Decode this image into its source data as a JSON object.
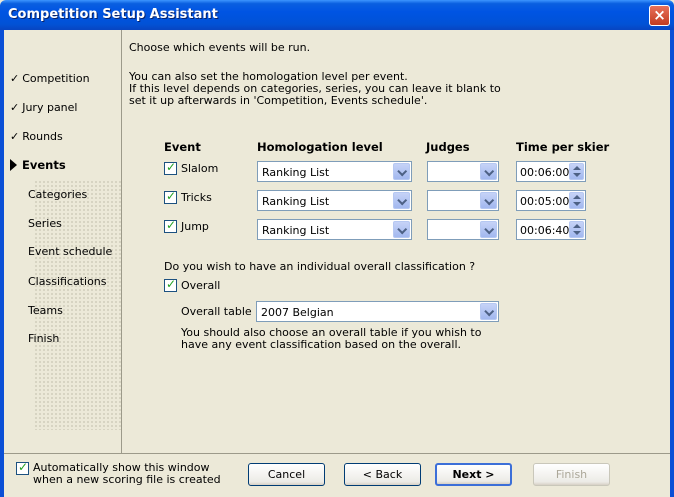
{
  "window": {
    "title": "Competition Setup Assistant",
    "close_glyph": "×"
  },
  "sidebar": {
    "items": [
      {
        "label": "Competition",
        "state": "done"
      },
      {
        "label": "Jury panel",
        "state": "done"
      },
      {
        "label": "Rounds",
        "state": "done"
      },
      {
        "label": "Events",
        "state": "current"
      },
      {
        "label": "Categories",
        "state": "todo"
      },
      {
        "label": "Series",
        "state": "todo"
      },
      {
        "label": "Event schedule",
        "state": "todo"
      },
      {
        "label": "Classifications",
        "state": "todo"
      },
      {
        "label": "Teams",
        "state": "todo"
      },
      {
        "label": "Finish",
        "state": "todo"
      }
    ]
  },
  "main": {
    "intro": "Choose which events will be run.",
    "info1": "You can also set the homologation level per event.",
    "info2": "If this level depends on categories, series, you can leave it blank to",
    "info3": "set it up afterwards in 'Competition, Events schedule'.",
    "headers": {
      "event": "Event",
      "homologation": "Homologation level",
      "judges": "Judges",
      "time": "Time per skier"
    },
    "events": [
      {
        "name": "Slalom",
        "checked": true,
        "homologation": "Ranking List",
        "judges": "",
        "time": "00:06:00"
      },
      {
        "name": "Tricks",
        "checked": true,
        "homologation": "Ranking List",
        "judges": "",
        "time": "00:05:00"
      },
      {
        "name": "Jump",
        "checked": true,
        "homologation": "Ranking List",
        "judges": "",
        "time": "00:06:40"
      }
    ],
    "overall_question": "Do you wish to have an individual overall classification ?",
    "overall_label": "Overall",
    "overall_checked": true,
    "overall_table_label": "Overall table :",
    "overall_table_value": "2007 Belgian",
    "overall_note1": "You should also choose an overall table if you whish to",
    "overall_note2": "have any event classification based on the overall."
  },
  "footer": {
    "auto_show_line1": "Automatically show this window",
    "auto_show_line2": "when a new scoring file is created",
    "auto_show_checked": true,
    "cancel": "Cancel",
    "back": "< Back",
    "next": "Next >",
    "finish": "Finish"
  }
}
